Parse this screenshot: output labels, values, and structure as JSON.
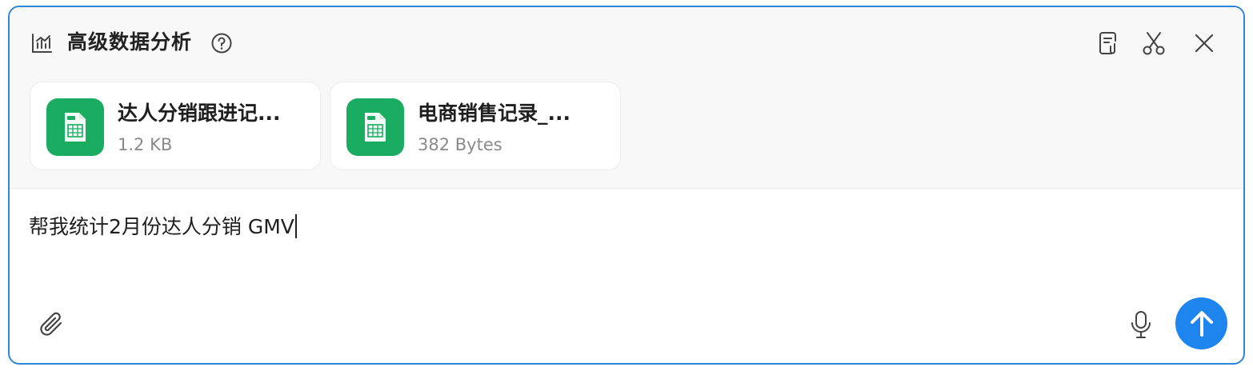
{
  "header": {
    "title": "高级数据分析",
    "icon": "chart-analysis-icon",
    "help_icon": "help-circle-icon",
    "tools": [
      "document-attachment-icon",
      "scissors-icon",
      "close-icon"
    ]
  },
  "files": [
    {
      "name": "达人分销跟进记...",
      "size": "1.2 KB",
      "icon": "csv-spreadsheet-icon"
    },
    {
      "name": "电商销售记录_...",
      "size": "382 Bytes",
      "icon": "csv-spreadsheet-icon"
    }
  ],
  "input": {
    "value": "帮我统计2月份达人分销 GMV"
  },
  "footer": {
    "attach_icon": "paperclip-icon",
    "mic_icon": "microphone-icon",
    "send_icon": "arrow-up-icon"
  },
  "colors": {
    "border": "#2f86d6",
    "accent": "#1e84ee",
    "file_icon_bg": "#1aad62"
  }
}
